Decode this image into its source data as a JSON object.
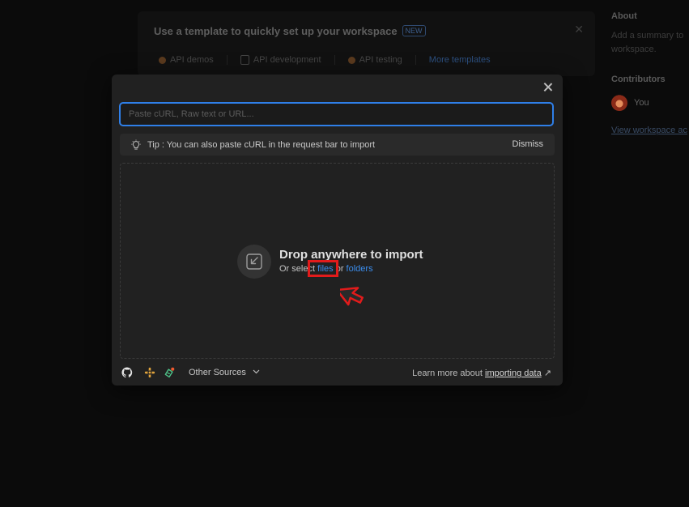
{
  "background": {
    "banner_title": "Use a template to quickly set up your workspace",
    "new_badge": "NEW",
    "templates": [
      "API demos",
      "API development",
      "API testing"
    ],
    "more_templates": "More templates",
    "about_heading": "About",
    "about_text_line1": "Add a summary to",
    "about_text_line2": "workspace.",
    "contributors_heading": "Contributors",
    "contributor_name": "You",
    "activity_link": "View workspace ac"
  },
  "modal": {
    "input_placeholder": "Paste cURL, Raw text or URL...",
    "tip_text": "Tip : You can also paste cURL in the request bar to import",
    "dismiss_label": "Dismiss",
    "drop_title": "Drop anywhere to import",
    "drop_sub_prefix": "Or select ",
    "files_link": "files",
    "or_text": " or ",
    "folders_link": "folders",
    "other_sources": "Other Sources",
    "learn_prefix": "Learn more about ",
    "learn_link": "importing data",
    "learn_suffix": " ↗"
  },
  "colors": {
    "accent": "#2f7fe8",
    "link": "#3b8ded",
    "annotation": "#e21b1b"
  },
  "icons": [
    "github-icon",
    "swagger-icon",
    "postman-notification-icon",
    "chevron-down-icon",
    "lightbulb-icon",
    "import-drop-icon",
    "close-icon"
  ]
}
